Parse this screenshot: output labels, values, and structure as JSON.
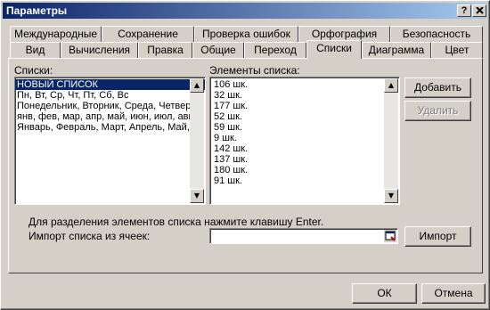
{
  "window": {
    "title": "Параметры",
    "help_btn": "?",
    "close_btn": "X"
  },
  "tabs_row1": [
    "Международные",
    "Сохранение",
    "Проверка ошибок",
    "Орфография",
    "Безопасность"
  ],
  "tabs_row2": [
    "Вид",
    "Вычисления",
    "Правка",
    "Общие",
    "Переход",
    "Списки",
    "Диаграмма",
    "Цвет"
  ],
  "active_tab": "Списки",
  "lists": {
    "label": "Списки:",
    "items": [
      "НОВЫЙ СПИСОК",
      "Пн, Вт, Ср, Чт, Пт, Сб, Вс",
      "Понедельник, Вторник, Среда, Четверг,",
      "янв, фев, мар, апр, май, июн, июл, авг,",
      "Январь, Февраль, Март, Апрель, Май, И"
    ]
  },
  "elements": {
    "label": "Элементы списка:",
    "items": [
      "106 шк.",
      "32 шк.",
      "177 шк.",
      "52 шк.",
      "59 шк.",
      "9 шк.",
      "142 шк.",
      "137 шк.",
      "180 шк.",
      "91 шк."
    ]
  },
  "buttons": {
    "add": "Добавить",
    "delete": "Удалить",
    "import": "Импорт",
    "ok": "ОК",
    "cancel": "Отмена"
  },
  "hint": "Для разделения элементов списка нажмите клавишу Enter.",
  "import_label": "Импорт списка из ячеек:",
  "import_value": ""
}
